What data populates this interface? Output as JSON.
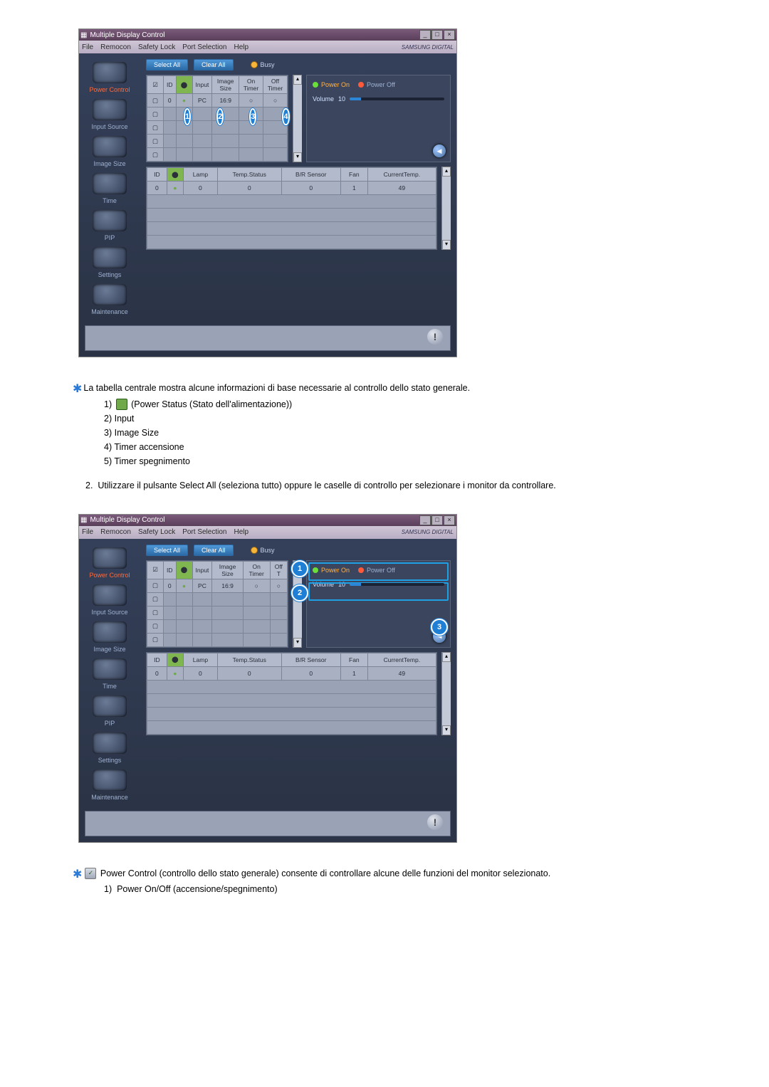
{
  "app": {
    "title": "Multiple Display Control",
    "brand": "SAMSUNG DIGITAL",
    "menus": [
      "File",
      "Remocon",
      "Safety Lock",
      "Port Selection",
      "Help"
    ]
  },
  "sidebar": {
    "items": [
      {
        "label": "Power Control",
        "active": true
      },
      {
        "label": "Input Source",
        "active": false
      },
      {
        "label": "Image Size",
        "active": false
      },
      {
        "label": "Time",
        "active": false
      },
      {
        "label": "PIP",
        "active": false
      },
      {
        "label": "Settings",
        "active": false
      },
      {
        "label": "Maintenance",
        "active": false
      }
    ]
  },
  "toolbar": {
    "select_all": "Select All",
    "clear_all": "Clear All",
    "busy": "Busy"
  },
  "top_grid": {
    "headers": [
      "",
      "ID",
      "",
      "Input",
      "Image Size",
      "On Timer",
      "Off Timer"
    ],
    "row": {
      "id": "0",
      "input": "PC",
      "image_size": "16:9"
    }
  },
  "bottom_grid": {
    "headers": [
      "ID",
      "",
      "Lamp",
      "Temp.Status",
      "B/R Sensor",
      "Fan",
      "CurrentTemp."
    ],
    "row": {
      "id": "0",
      "lamp": "0",
      "temp_status": "0",
      "br": "0",
      "fan": "1",
      "ctemp": "49"
    }
  },
  "panel": {
    "power_on": "Power On",
    "power_off": "Power Off",
    "volume_label": "Volume",
    "volume_value": "10"
  },
  "notes1": {
    "intro": "La tabella centrale mostra alcune informazioni di base necessarie al controllo dello stato generale.",
    "i1": "(Power Status (Stato dell'alimentazione))",
    "i2": "Input",
    "i3": "Image Size",
    "i4": "Timer accensione",
    "i5": "Timer spegnimento",
    "step2": "Utilizzare il pulsante Select All (seleziona tutto) oppure le caselle di controllo per selezionare i monitor da controllare."
  },
  "notes2": {
    "intro": "Power Control (controllo dello stato generale) consente di controllare alcune delle funzioni del monitor selezionato.",
    "i1": "Power On/Off (accensione/spegnimento)"
  }
}
